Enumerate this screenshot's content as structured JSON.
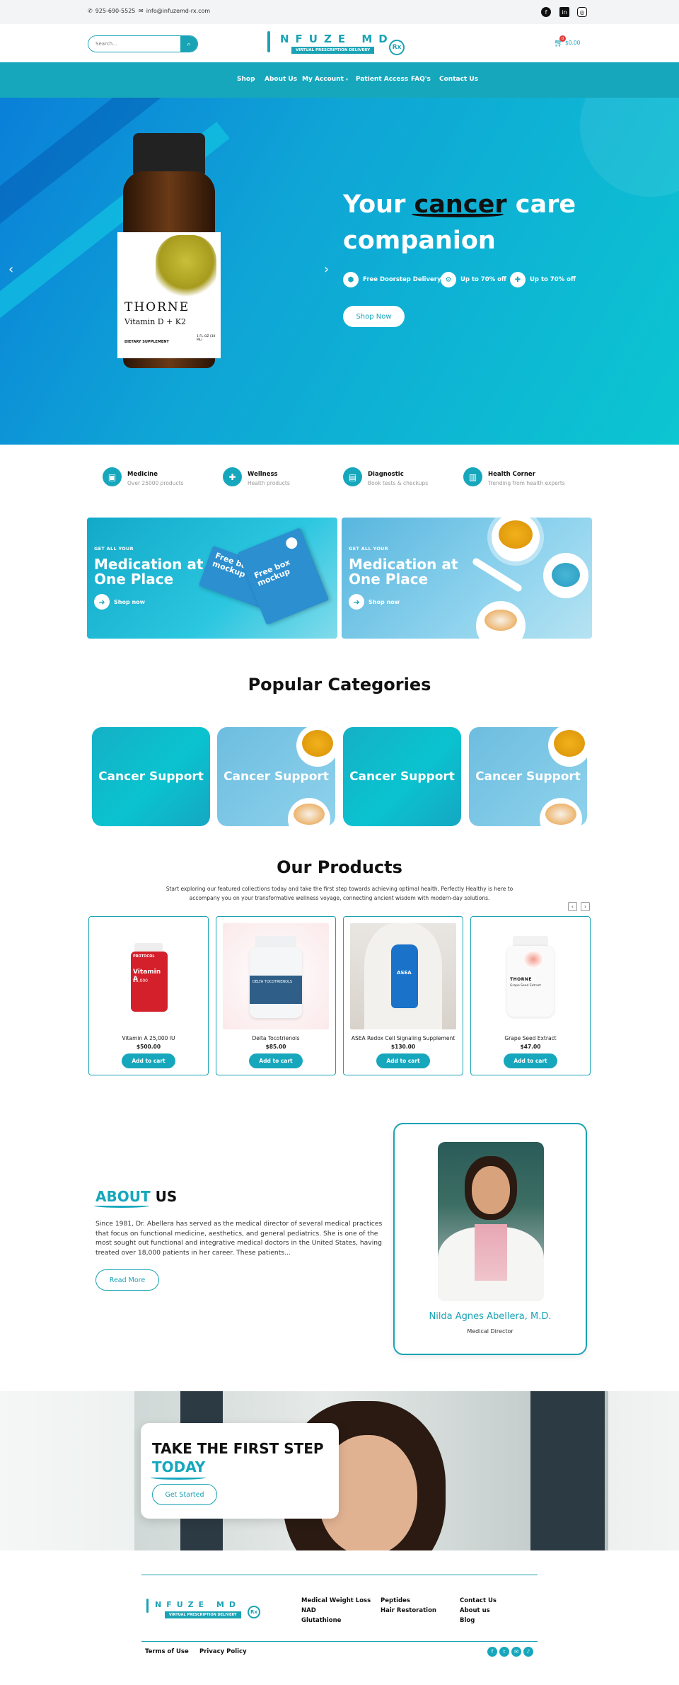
{
  "topbar": {
    "phone": "925-690-5525",
    "email": "info@infuzemd-rx.com",
    "social": [
      "facebook-icon",
      "linkedin-icon",
      "instagram-icon"
    ]
  },
  "header": {
    "search_placeholder": "Search...",
    "logo_text": "NFUZE MD",
    "logo_tagline": "VIRTUAL PRESCRIPTION DELIVERY",
    "logo_rx": "Rx",
    "cart_count": "0",
    "cart_total": "$0.00"
  },
  "nav": {
    "items": [
      "Shop",
      "About Us",
      "My Account",
      "Patient Access",
      "FAQ's",
      "Contact Us"
    ]
  },
  "hero": {
    "title_pre": "Your ",
    "title_highlight": "cancer",
    "title_post": " care",
    "title_line2": "companion",
    "features": [
      "Free Doorstep Delivery",
      "Up to 70% off",
      "Up to 70% off"
    ],
    "cta": "Shop Now",
    "bottle_brand": "THORNE",
    "bottle_product": "Vitamin D + K2",
    "bottle_sub": "DIETARY SUPPLEMENT",
    "bottle_volume": "1 FL OZ (30 ML)",
    "prev": "‹",
    "next": "›"
  },
  "feature_row": [
    {
      "title": "Medicine",
      "subtitle": "Over 25000 products"
    },
    {
      "title": "Wellness",
      "subtitle": "Health products"
    },
    {
      "title": "Diagnostic",
      "subtitle": "Book tests & checkups"
    },
    {
      "title": "Health Corner",
      "subtitle": "Trending from health experts"
    }
  ],
  "promos": [
    {
      "small": "GET ALL YOUR",
      "title_l1": "Medication at",
      "title_l2": "One Place",
      "shop": "Shop now",
      "box_text": "Free box mockup"
    },
    {
      "small": "GET ALL YOUR",
      "title_l1": "Medication at",
      "title_l2": "One Place",
      "shop": "Shop now"
    }
  ],
  "categories": {
    "title": "Popular Categories",
    "items": [
      "Cancer Support",
      "Cancer Support",
      "Cancer Support",
      "Cancer Support"
    ]
  },
  "products": {
    "title": "Our Products",
    "description_l1": "Start exploring our featured collections today and take the first step towards achieving optimal health. Perfectly Healthy is here to",
    "description_l2": "accompany you on your transformative wellness voyage, connecting ancient wisdom with modern-day solutions.",
    "add_to_cart": "Add to cart",
    "prev": "‹",
    "next": "›",
    "items": [
      {
        "name": "Vitamin A 25,000 IU",
        "price": "$500.00",
        "brand": "PROTOCOL",
        "label": "Vitamin A",
        "sub": "25,000"
      },
      {
        "name": "Delta Tocotrienols",
        "price": "$85.00",
        "brand": "DELTA TOCOTRIENOLS"
      },
      {
        "name": "ASEA Redox Cell Signaling Supplement",
        "price": "$130.00",
        "brand": "ASEA"
      },
      {
        "name": "Grape Seed Extract",
        "price": "$47.00",
        "brand": "THORNE",
        "sub": "Grape Seed Extract"
      }
    ]
  },
  "about": {
    "title_highlight": "ABOUT",
    "title_rest": " US",
    "lines": [
      "Since 1981, Dr. Abellera has served as the medical director of several medical practices",
      "that focus on functional medicine, aesthetics, and general pediatrics. She is one of the",
      "most sought out functional and integrative medical doctors in the United States, having",
      "treated over 18,000 patients in her career. These patients..."
    ],
    "read_more": "Read More",
    "doctor_name": "Nilda Agnes Abellera, M.D.",
    "doctor_role": "Medical Director"
  },
  "cta": {
    "line1": "TAKE THE FIRST STEP",
    "line2": "TODAY",
    "button": "Get Started"
  },
  "footer": {
    "col1": [
      "Medical Weight Loss",
      "NAD",
      "Glutathione"
    ],
    "col2": [
      "Peptides",
      "Hair Restoration"
    ],
    "col3": [
      "Contact Us",
      "About us",
      "Blog"
    ],
    "bottom": [
      "Terms of Use",
      "Privacy Policy"
    ],
    "social": [
      "facebook-icon",
      "twitter-icon",
      "email-icon",
      "tiktok-icon"
    ]
  },
  "colors": {
    "accent": "#17a7bd",
    "hero_start": "#0a7fd8",
    "hero_end": "#0cc6d1"
  }
}
